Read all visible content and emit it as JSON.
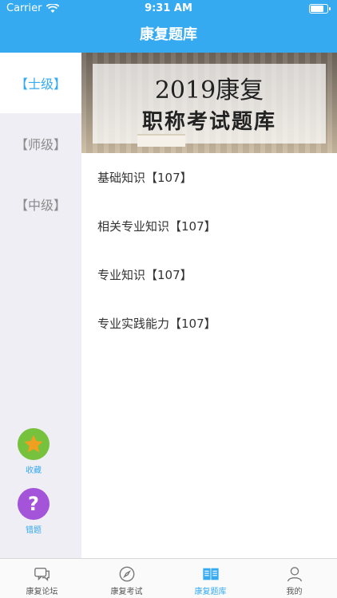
{
  "status": {
    "carrier": "Carrier",
    "time": "9:31 AM",
    "icons": [
      "wifi-icon",
      "battery-icon"
    ]
  },
  "nav": {
    "title": "康复题库"
  },
  "sidebar": {
    "levels": [
      {
        "label": "【士级】",
        "active": true
      },
      {
        "label": "【师级】",
        "active": false
      },
      {
        "label": "【中级】",
        "active": false
      }
    ],
    "favorite_label": "收藏",
    "wrong_label": "错题",
    "wrong_glyph": "?"
  },
  "banner": {
    "line1": "2019康复",
    "line2": "职称考试题库"
  },
  "items": [
    "基础知识【107】",
    "相关专业知识【107】",
    "专业知识【107】",
    "专业实践能力【107】"
  ],
  "tabs": [
    {
      "label": "康复论坛",
      "icon": "chat-icon",
      "active": false
    },
    {
      "label": "康复考试",
      "icon": "compass-icon",
      "active": false
    },
    {
      "label": "康复题库",
      "icon": "book-icon",
      "active": true
    },
    {
      "label": "我的",
      "icon": "person-icon",
      "active": false
    }
  ],
  "colors": {
    "accent": "#35aaf0",
    "favorite": "#76c23d",
    "star": "#f0a020",
    "wrong": "#a354d8"
  }
}
